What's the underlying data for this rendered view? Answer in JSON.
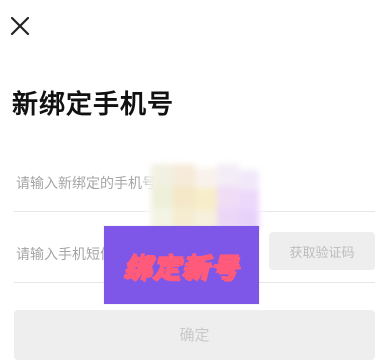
{
  "header": {
    "close_icon": "close-icon"
  },
  "page": {
    "title": "新绑定手机号"
  },
  "form": {
    "phone_placeholder": "请输入新绑定的手机号",
    "code_placeholder": "请输入手机短信验证码",
    "get_code_label": "获取验证码",
    "confirm_label": "确定"
  },
  "overlay": {
    "label": "绑定新号",
    "color": "#7e57e8",
    "text_outline_color": "#ff5a7a"
  },
  "colors": {
    "disabled_button_bg": "#eeeeee",
    "disabled_button_text": "#bdbdbd",
    "placeholder_text": "#a5a5a5"
  }
}
